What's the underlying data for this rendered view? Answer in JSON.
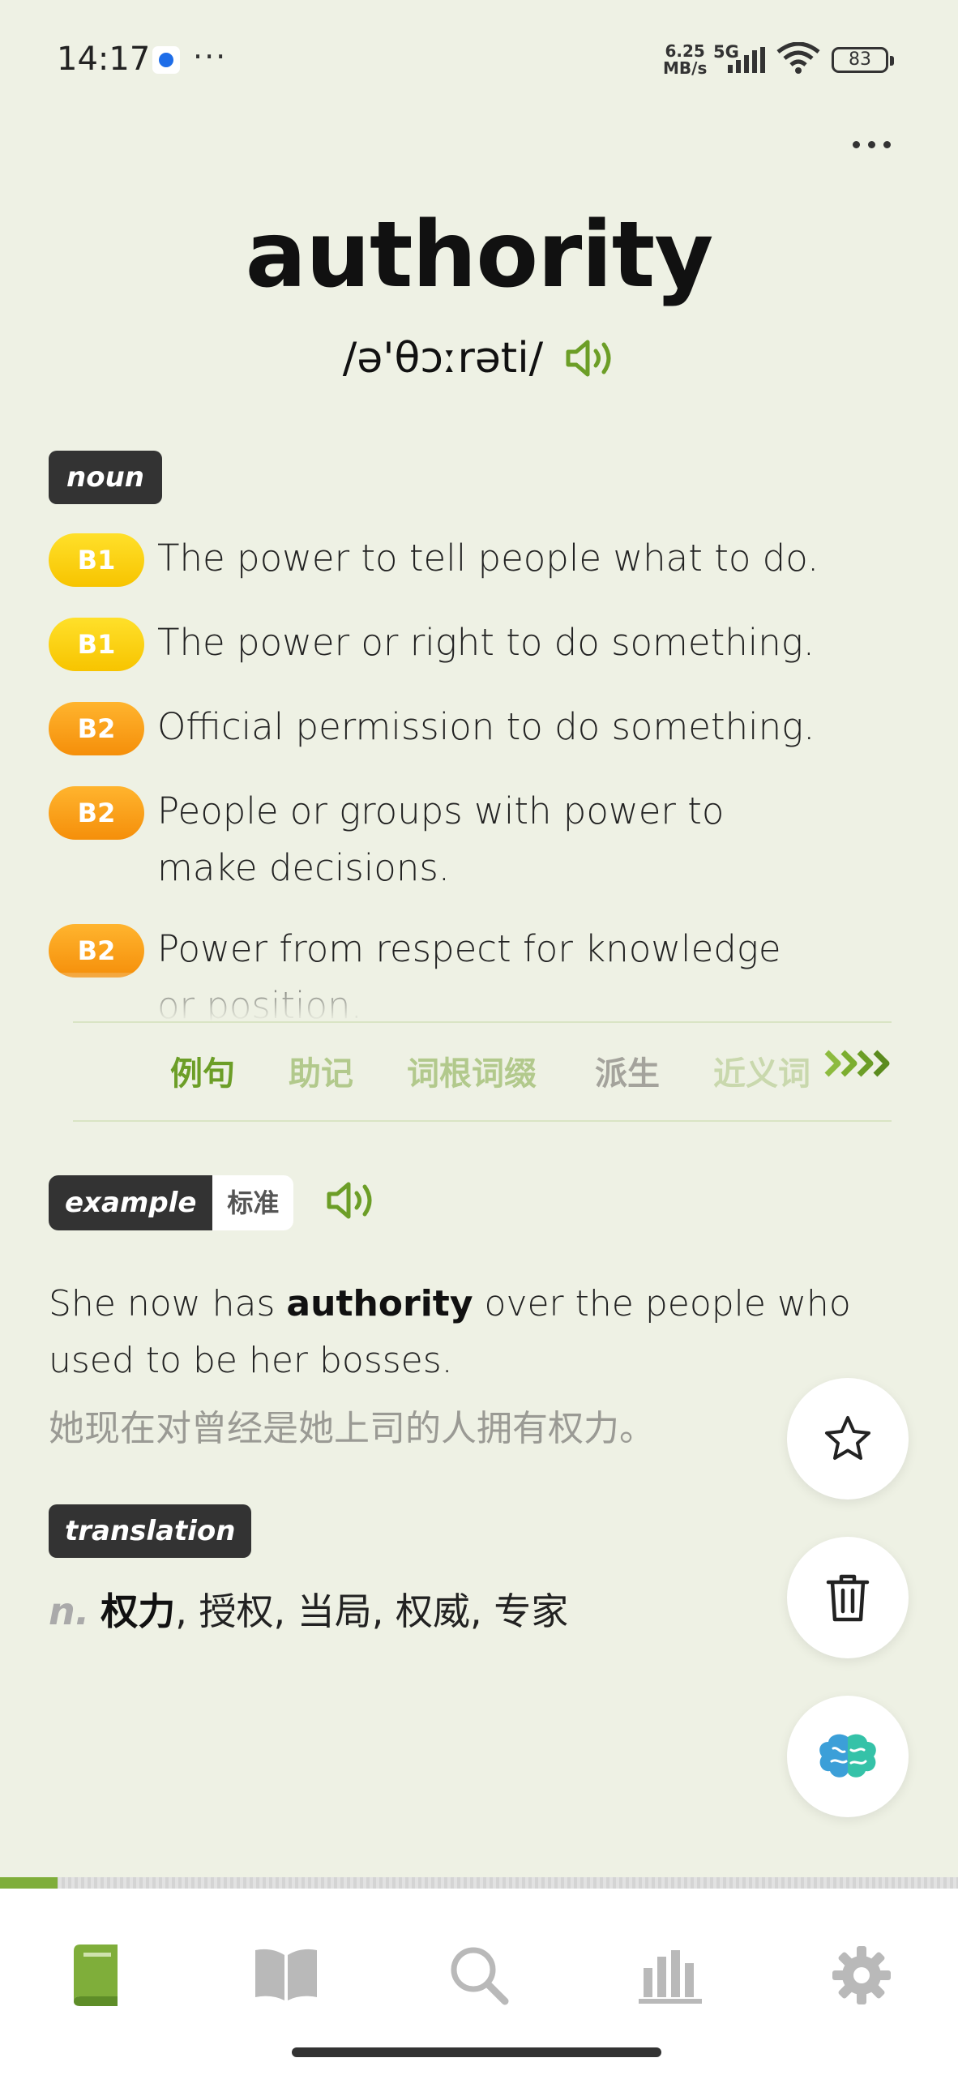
{
  "status_bar": {
    "time": "14:17",
    "network_speed_value": "6.25",
    "network_speed_unit": "MB/s",
    "network_type": "5G",
    "battery": "83",
    "icons": [
      "app-notification-icon",
      "overflow-dots-icon",
      "signal-icon",
      "wifi-icon",
      "battery-icon"
    ]
  },
  "entry": {
    "word": "authority",
    "phonetic": "/ə'θɔːrəti/",
    "part_of_speech": "noun",
    "senses": [
      {
        "level": "B1",
        "definition": "The power to tell people what to do."
      },
      {
        "level": "B1",
        "definition": "The power or right to do something."
      },
      {
        "level": "B2",
        "definition": "Official permission to do something."
      },
      {
        "level": "B2",
        "definition": "People or groups with power to make decisions."
      },
      {
        "level": "B2",
        "definition": "Power from respect for knowledge or position."
      }
    ]
  },
  "tabs": [
    {
      "label": "例句",
      "active": true
    },
    {
      "label": "助记",
      "active": false
    },
    {
      "label": "词根词缀",
      "active": false
    },
    {
      "label": "派生",
      "active": false
    },
    {
      "label": "近义词",
      "active": false
    }
  ],
  "example": {
    "tag": "example",
    "variant": "标准",
    "sentence_before": "She now has ",
    "sentence_keyword": "authority",
    "sentence_after": " over the people who used to be her bosses.",
    "translation": "她现在对曾经是她上司的人拥有权力。"
  },
  "translation": {
    "tag": "translation",
    "pos": "n.",
    "first": "权力",
    "rest": ", 授权, 当局, 权威, 专家"
  },
  "fab_icons": [
    "star-icon",
    "trash-icon",
    "brain-icon"
  ],
  "progress_fraction": 0.06,
  "bottom_nav": [
    "word-book-icon",
    "open-book-icon",
    "search-icon",
    "stats-icon",
    "settings-gear-icon"
  ],
  "colors": {
    "background": "#eef1e4",
    "accent_green": "#6c9e27",
    "b1": "#f9cf0a",
    "b2": "#f7a01c",
    "tag_dark": "#333333"
  }
}
